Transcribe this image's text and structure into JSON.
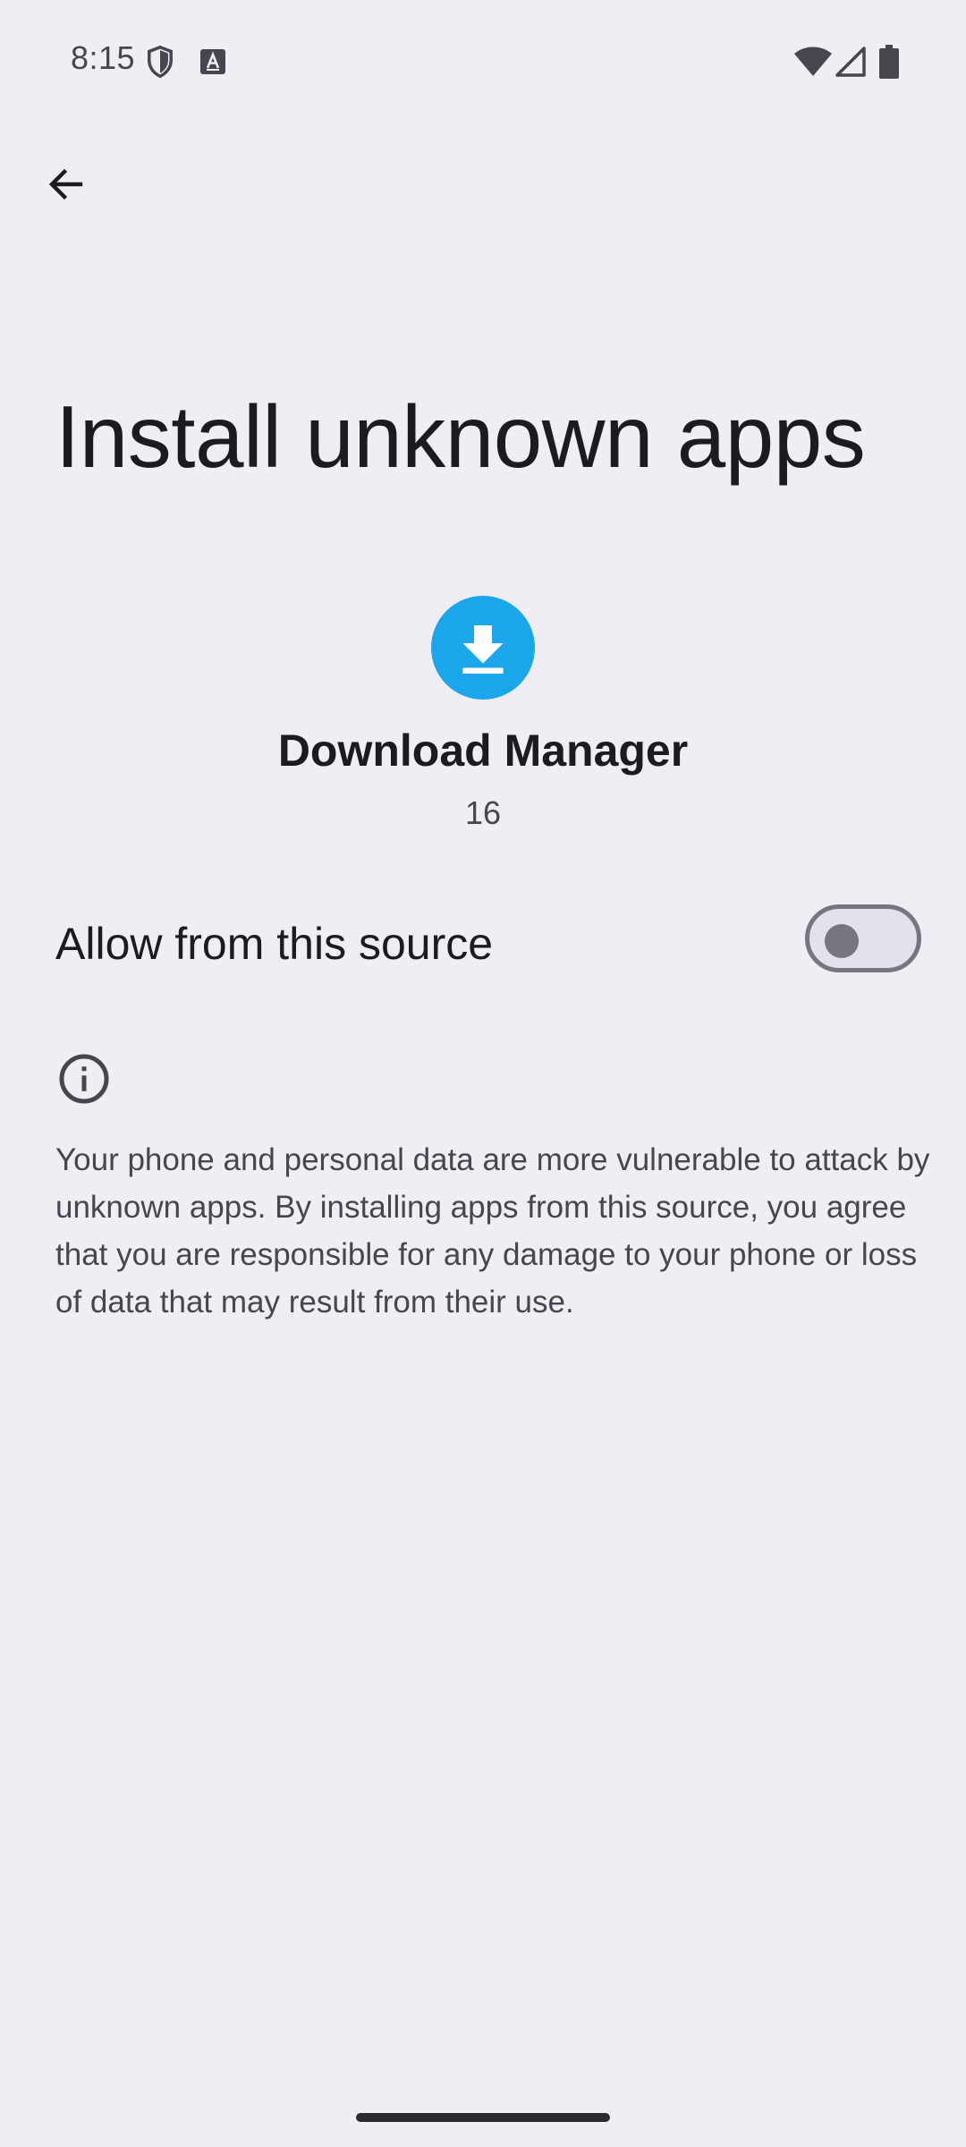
{
  "status_bar": {
    "time": "8:15",
    "icons": [
      "shield-icon",
      "keyboard-a-icon",
      "wifi-icon",
      "cell-signal-icon",
      "battery-icon"
    ]
  },
  "nav": {
    "back_icon": "arrow-back-icon"
  },
  "page": {
    "title": "Install unknown apps"
  },
  "app": {
    "icon": "download-icon",
    "icon_color": "#1ba6ec",
    "name": "Download Manager",
    "version": "16"
  },
  "allow_setting": {
    "label": "Allow from this source",
    "enabled": false
  },
  "info": {
    "icon": "info-icon",
    "text": "Your phone and personal data are more vulnerable to attack by unknown apps. By installing apps from this source, you agree that you are responsible for any damage to your phone or loss of data that may result from their use."
  }
}
